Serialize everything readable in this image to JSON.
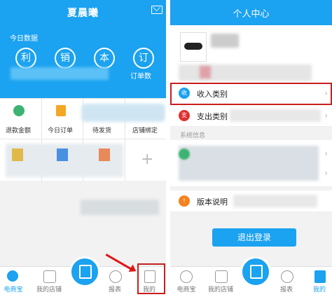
{
  "left": {
    "title": "夏晨曦",
    "today_label": "今日数据",
    "stats": [
      {
        "glyph": "利",
        "label": ""
      },
      {
        "glyph": "销",
        "label": ""
      },
      {
        "glyph": "本",
        "label": ""
      },
      {
        "glyph": "订",
        "label": "订单数"
      }
    ],
    "grid": [
      {
        "label": "退款金额",
        "icon_color": "#3cb371"
      },
      {
        "label": "今日订单",
        "icon_color": "#f5a623"
      },
      {
        "label": "待发货",
        "icon_color": "#4a90e2"
      },
      {
        "label": "店铺绑定",
        "icon_color": "#e8a07a"
      }
    ],
    "tabs": [
      {
        "label": "电商宝"
      },
      {
        "label": "我的店铺"
      },
      {
        "label": ""
      },
      {
        "label": "报表"
      },
      {
        "label": "我的"
      }
    ]
  },
  "right": {
    "title": "个人中心",
    "rows": [
      {
        "label": "收入类别",
        "icon": "收",
        "color": "#1ba2f0"
      },
      {
        "label": "支出类别",
        "icon": "支",
        "color": "#e0312f"
      }
    ],
    "section_label": "系统信息",
    "version_label": "版本说明",
    "version_icon": "!",
    "version_color": "#f58220",
    "logout": "退出登录",
    "tabs": [
      {
        "label": "电商宝"
      },
      {
        "label": "我的店铺"
      },
      {
        "label": ""
      },
      {
        "label": "报表"
      },
      {
        "label": "我的"
      }
    ]
  }
}
